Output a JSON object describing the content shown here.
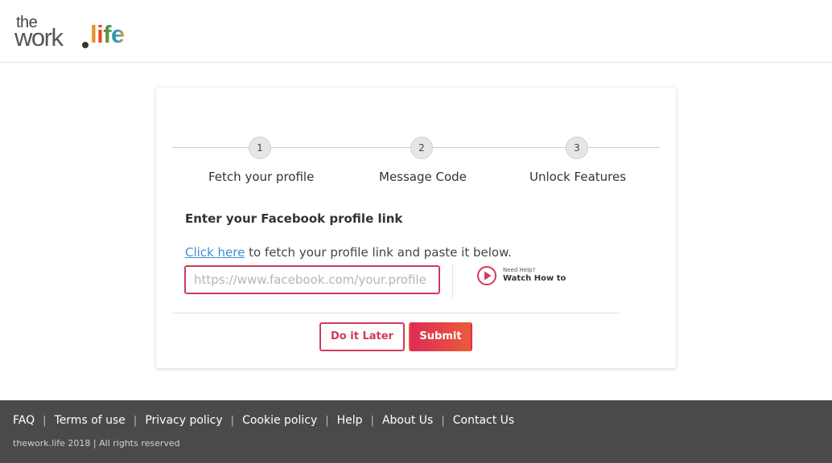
{
  "brand": {
    "the": "the",
    "work": "work",
    "life": "life"
  },
  "steps": [
    {
      "number": "1",
      "label": "Fetch your profile"
    },
    {
      "number": "2",
      "label": "Message Code"
    },
    {
      "number": "3",
      "label": "Unlock Features"
    }
  ],
  "form": {
    "title": "Enter your Facebook profile link",
    "link_text": "Click here",
    "instruction_rest": " to fetch your profile link and paste it below.",
    "input_placeholder": "https://www.facebook.com/your.profile",
    "input_value": ""
  },
  "help": {
    "small": "Need Help?",
    "main": "Watch How to"
  },
  "buttons": {
    "later": "Do it Later",
    "submit": "Submit"
  },
  "footer": {
    "links": [
      "FAQ",
      "Terms of use",
      "Privacy policy",
      "Cookie policy",
      "Help",
      "About Us",
      "Contact Us"
    ],
    "separator": "|",
    "copyright": "thework.life 2018 | All rights reserved"
  },
  "colors": {
    "accent": "#d23a5a",
    "link": "#3a8fd6",
    "footer_bg": "#4a4a4a",
    "submit_gradient_start": "#de2c55",
    "submit_gradient_end": "#ea5a3a"
  },
  "icons": {
    "help": "play-circle-icon"
  }
}
